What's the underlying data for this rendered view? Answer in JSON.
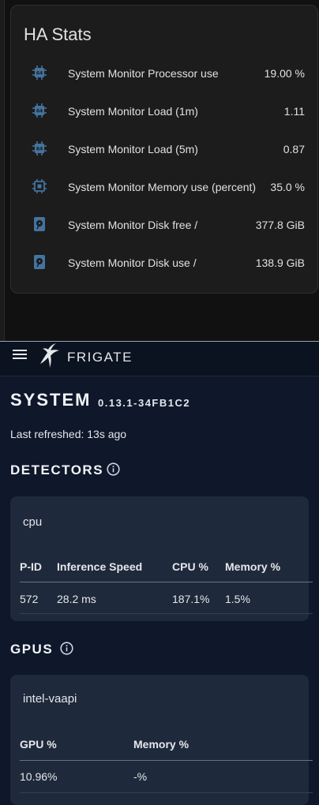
{
  "ha": {
    "title": "HA Stats",
    "rows": [
      {
        "label": "System Monitor Processor use",
        "value": "19.00 %",
        "icon": "cpu-64bit-icon"
      },
      {
        "label": "System Monitor Load (1m)",
        "value": "1.11",
        "icon": "cpu-64bit-icon"
      },
      {
        "label": "System Monitor Load (5m)",
        "value": "0.87",
        "icon": "cpu-64bit-icon"
      },
      {
        "label": "System Monitor Memory use (percent)",
        "value": "35.0 %",
        "icon": "memory-chip-icon"
      },
      {
        "label": "System Monitor Disk free /",
        "value": "377.8 GiB",
        "icon": "harddisk-icon"
      },
      {
        "label": "System Monitor Disk use /",
        "value": "138.9 GiB",
        "icon": "harddisk-icon"
      }
    ],
    "icon_color": "#44739e"
  },
  "frigate": {
    "brand": "FRIGATE",
    "system_title": "SYSTEM",
    "version": "0.13.1-34FB1C2",
    "last_refreshed": "Last refreshed: 13s ago",
    "detectors": {
      "heading": "DETECTORS",
      "name": "cpu",
      "columns": [
        "P-ID",
        "Inference Speed",
        "CPU %",
        "Memory %"
      ],
      "row": [
        "572",
        "28.2 ms",
        "187.1%",
        "1.5%"
      ]
    },
    "gpus": {
      "heading": "GPUS",
      "name": "intel-vaapi",
      "columns": [
        "GPU %",
        "Memory %"
      ],
      "row": [
        "10.96%",
        "-%"
      ]
    }
  }
}
